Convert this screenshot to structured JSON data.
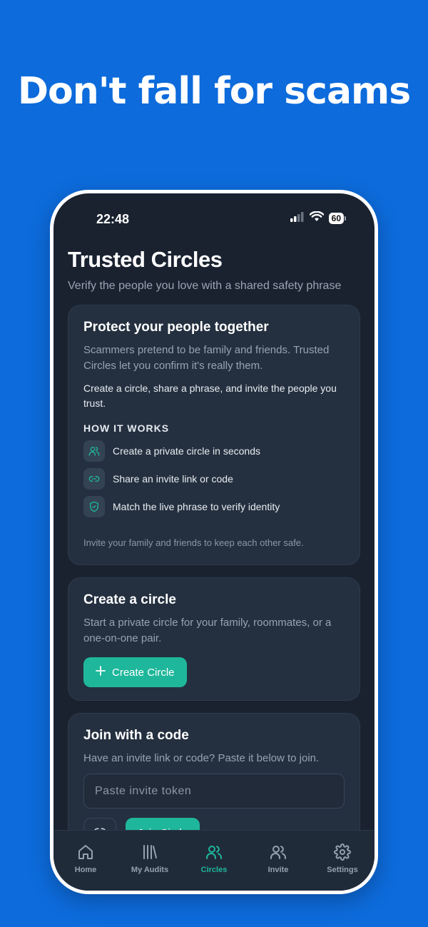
{
  "headline": "Don't fall for scams",
  "status": {
    "time": "22:48",
    "battery": "60"
  },
  "page": {
    "title": "Trusted Circles",
    "subtitle": "Verify the people you love with a shared safety phrase"
  },
  "intro_card": {
    "title": "Protect your people together",
    "muted": "Scammers pretend to be family and friends. Trusted Circles let you confirm it's really them.",
    "body": "Create a circle, share a phrase, and invite the people you trust.",
    "section_label": "HOW IT WORKS",
    "steps": [
      {
        "icon": "users-icon",
        "text": "Create a private circle in seconds"
      },
      {
        "icon": "link-icon",
        "text": "Share an invite link or code"
      },
      {
        "icon": "shield-check-icon",
        "text": "Match the live phrase to verify identity"
      }
    ],
    "footnote": "Invite your family and friends to keep each other safe."
  },
  "create_card": {
    "title": "Create a circle",
    "muted": "Start a private circle for your family, roommates, or a one-on-one pair.",
    "button": "Create Circle"
  },
  "join_card": {
    "title": "Join with a code",
    "muted": "Have an invite link or code? Paste it below to join.",
    "input_placeholder": "Paste invite token",
    "button": "Join Circle"
  },
  "tabs": [
    {
      "label": "Home",
      "icon": "home-icon",
      "active": false
    },
    {
      "label": "My Audits",
      "icon": "library-icon",
      "active": false
    },
    {
      "label": "Circles",
      "icon": "users-icon",
      "active": true
    },
    {
      "label": "Invite",
      "icon": "users-icon",
      "active": false
    },
    {
      "label": "Settings",
      "icon": "gear-icon",
      "active": false
    }
  ],
  "colors": {
    "background": "#0d6bdb",
    "screen": "#1a2230",
    "card": "#243040",
    "accent": "#1fb79b"
  }
}
